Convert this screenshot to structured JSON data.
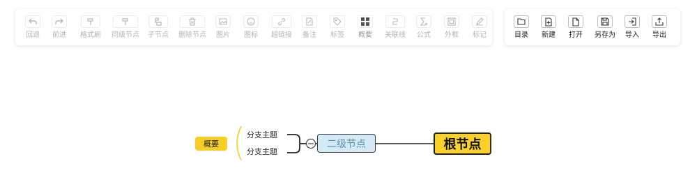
{
  "toolbar_left": {
    "items": [
      {
        "label": "回退",
        "icon": "undo-icon"
      },
      {
        "label": "前进",
        "icon": "redo-icon"
      },
      {
        "label": "格式刷",
        "icon": "format-painter-icon"
      },
      {
        "label": "同级节点",
        "icon": "sibling-node-icon"
      },
      {
        "label": "子节点",
        "icon": "child-node-icon"
      },
      {
        "label": "删除节点",
        "icon": "delete-node-icon"
      },
      {
        "label": "图片",
        "icon": "image-icon"
      },
      {
        "label": "图标",
        "icon": "emoji-icon"
      },
      {
        "label": "超链接",
        "icon": "link-icon"
      },
      {
        "label": "备注",
        "icon": "note-icon"
      },
      {
        "label": "标签",
        "icon": "tag-icon"
      },
      {
        "label": "概要",
        "icon": "summary-icon"
      },
      {
        "label": "关联线",
        "icon": "relation-line-icon"
      },
      {
        "label": "公式",
        "icon": "formula-icon"
      },
      {
        "label": "外框",
        "icon": "outer-frame-icon"
      },
      {
        "label": "标记",
        "icon": "mark-icon"
      }
    ]
  },
  "toolbar_right": {
    "items": [
      {
        "label": "目录",
        "icon": "folder-icon"
      },
      {
        "label": "新建",
        "icon": "new-file-icon"
      },
      {
        "label": "打开",
        "icon": "open-file-icon"
      },
      {
        "label": "另存为",
        "icon": "save-as-icon"
      },
      {
        "label": "导入",
        "icon": "import-icon"
      },
      {
        "label": "导出",
        "icon": "export-icon"
      }
    ]
  },
  "mindmap": {
    "root": "根节点",
    "second_level": "二级节点",
    "branches": [
      "分支主题",
      "分支主题"
    ],
    "summary": "概要",
    "collapse_symbol": "−"
  },
  "colors": {
    "root_fill": "#f9d12a",
    "second_fill": "#d4eaf7",
    "summary_fill": "#f7ce25",
    "summary_brace": "#f7ce25",
    "disabled_text": "#b4b4b4"
  }
}
